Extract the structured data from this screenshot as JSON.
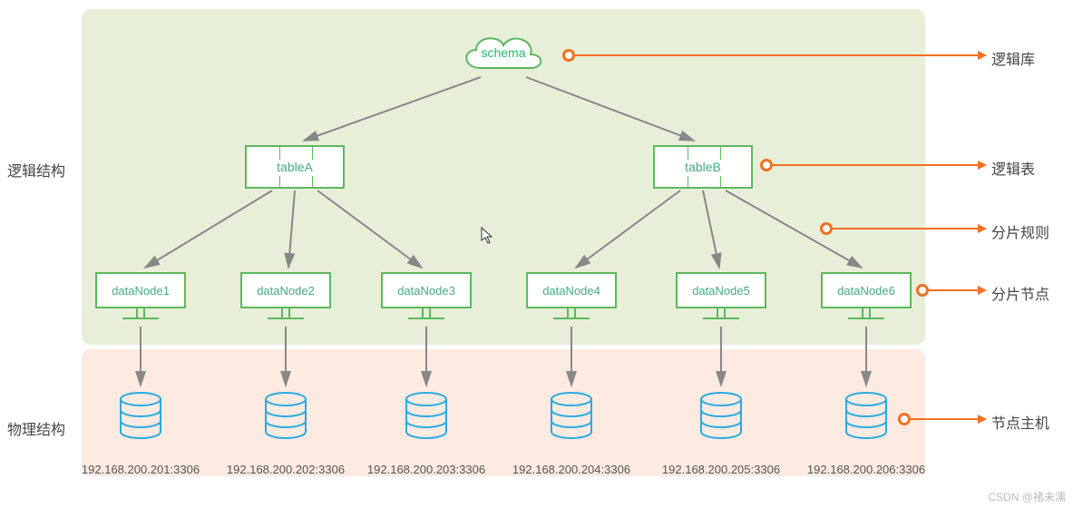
{
  "sideLabels": {
    "logical": "逻辑结构",
    "physical": "物理结构"
  },
  "legend": {
    "schema": "逻辑库",
    "table": "逻辑表",
    "rule": "分片规则",
    "node": "分片节点",
    "host": "节点主机"
  },
  "schema": {
    "label": "schema"
  },
  "tables": {
    "a": "tableA",
    "b": "tableB"
  },
  "dataNodes": [
    "dataNode1",
    "dataNode2",
    "dataNode3",
    "dataNode4",
    "dataNode5",
    "dataNode6"
  ],
  "hosts": [
    "192.168.200.201:3306",
    "192.168.200.202:3306",
    "192.168.200.203:3306",
    "192.168.200.204:3306",
    "192.168.200.205:3306",
    "192.168.200.206:3306"
  ],
  "watermark": "CSDN @褚未濡"
}
